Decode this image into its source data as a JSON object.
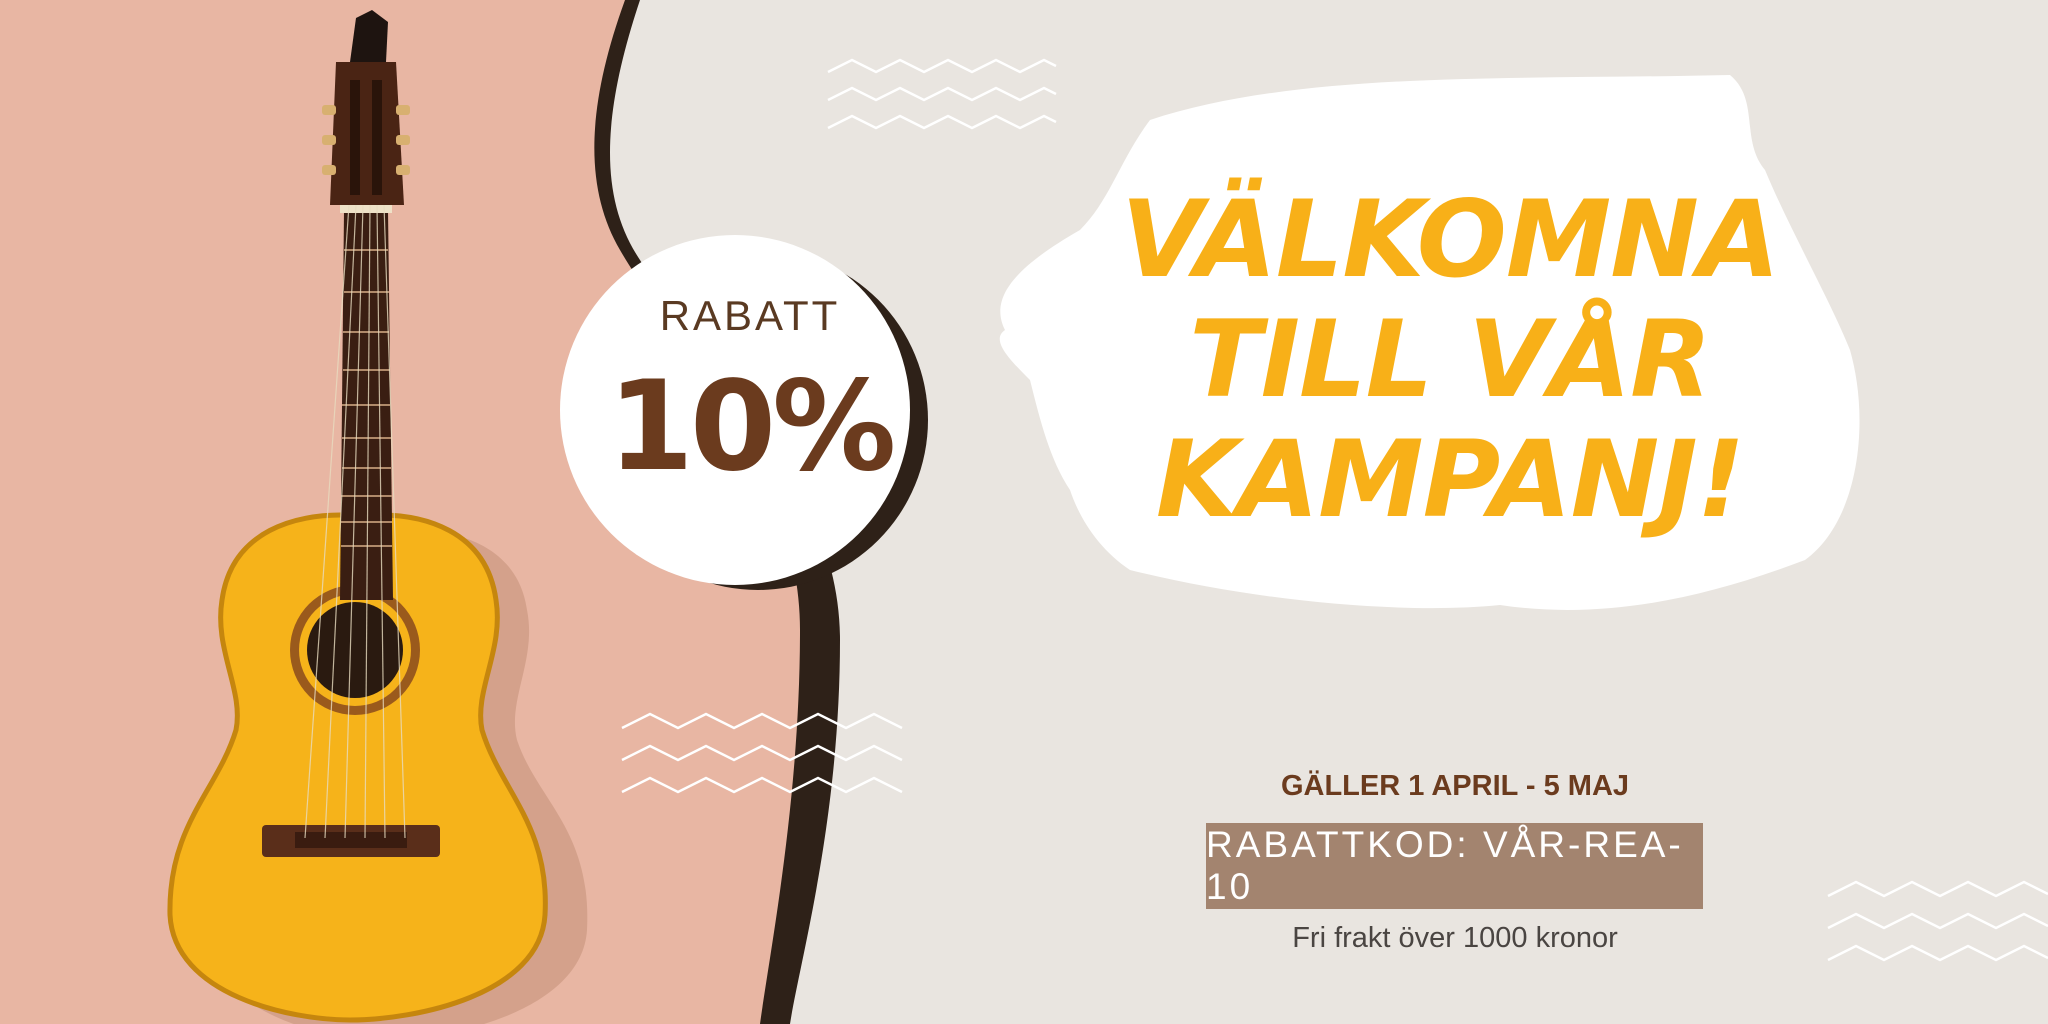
{
  "badge": {
    "label": "RABATT",
    "value": "10%"
  },
  "headline": {
    "line1": "VÄLKOMNA",
    "line2": "TILL VÅR",
    "line3": "KAMPANJ!"
  },
  "validity": "GÄLLER 1 APRIL - 5 MAJ",
  "discount_code": "RABATTKOD: VÅR-REA-10",
  "shipping_note": "Fri frakt över 1000 kronor",
  "colors": {
    "background": "#e9e5e0",
    "photo_background": "#e8b6a3",
    "headline": "#f8b018",
    "brown_text": "#6b3b1e",
    "code_box": "#a3846f"
  },
  "icons": [
    "zigzag-pattern",
    "guitar-photo",
    "brush-stroke"
  ]
}
